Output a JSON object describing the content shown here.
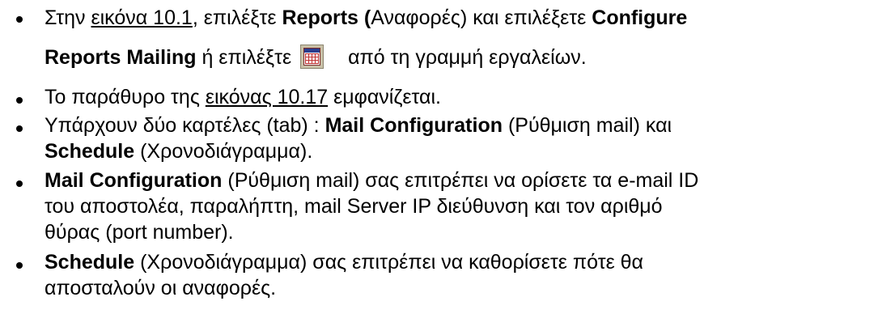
{
  "items": [
    {
      "lines": [
        [
          "Στην ",
          "εικόνα 10.1",
          ", επιλέξτε ",
          "Reports (",
          "Αναφορές) και επιλέξετε ",
          "Configure"
        ],
        [
          "Reports Mailing",
          " ή επιλέξτε ",
          "από τη γραμμή εργαλείων."
        ]
      ],
      "toolbar_icon": "calendar-schedule-icon"
    },
    {
      "lines": [
        [
          "Το παράθυρο της ",
          "εικόνας 10.17",
          " εμφανίζεται."
        ]
      ]
    },
    {
      "lines": [
        [
          "Υπάρχουν δύο καρτέλες (tab) : ",
          "Mail Configuration",
          " (Ρύθμιση mail) και"
        ],
        [
          "Schedule",
          " (Χρονοδιάγραμμα)."
        ]
      ]
    },
    {
      "lines": [
        [
          "Mail Configuration",
          " (Ρύθμιση mail) σας επιτρέπει να ορίσετε τα e-mail ID"
        ],
        [
          "του αποστολέα, παραλήπτη, mail Server IP διεύθυνση και τον αριθμό"
        ],
        [
          "θύρας (port number)."
        ]
      ]
    },
    {
      "lines": [
        [
          "Schedule",
          " (Χρονοδιάγραμμα) σας επιτρέπει να καθορίσετε πότε θα"
        ],
        [
          "αποσταλούν οι αναφορές."
        ]
      ]
    }
  ]
}
